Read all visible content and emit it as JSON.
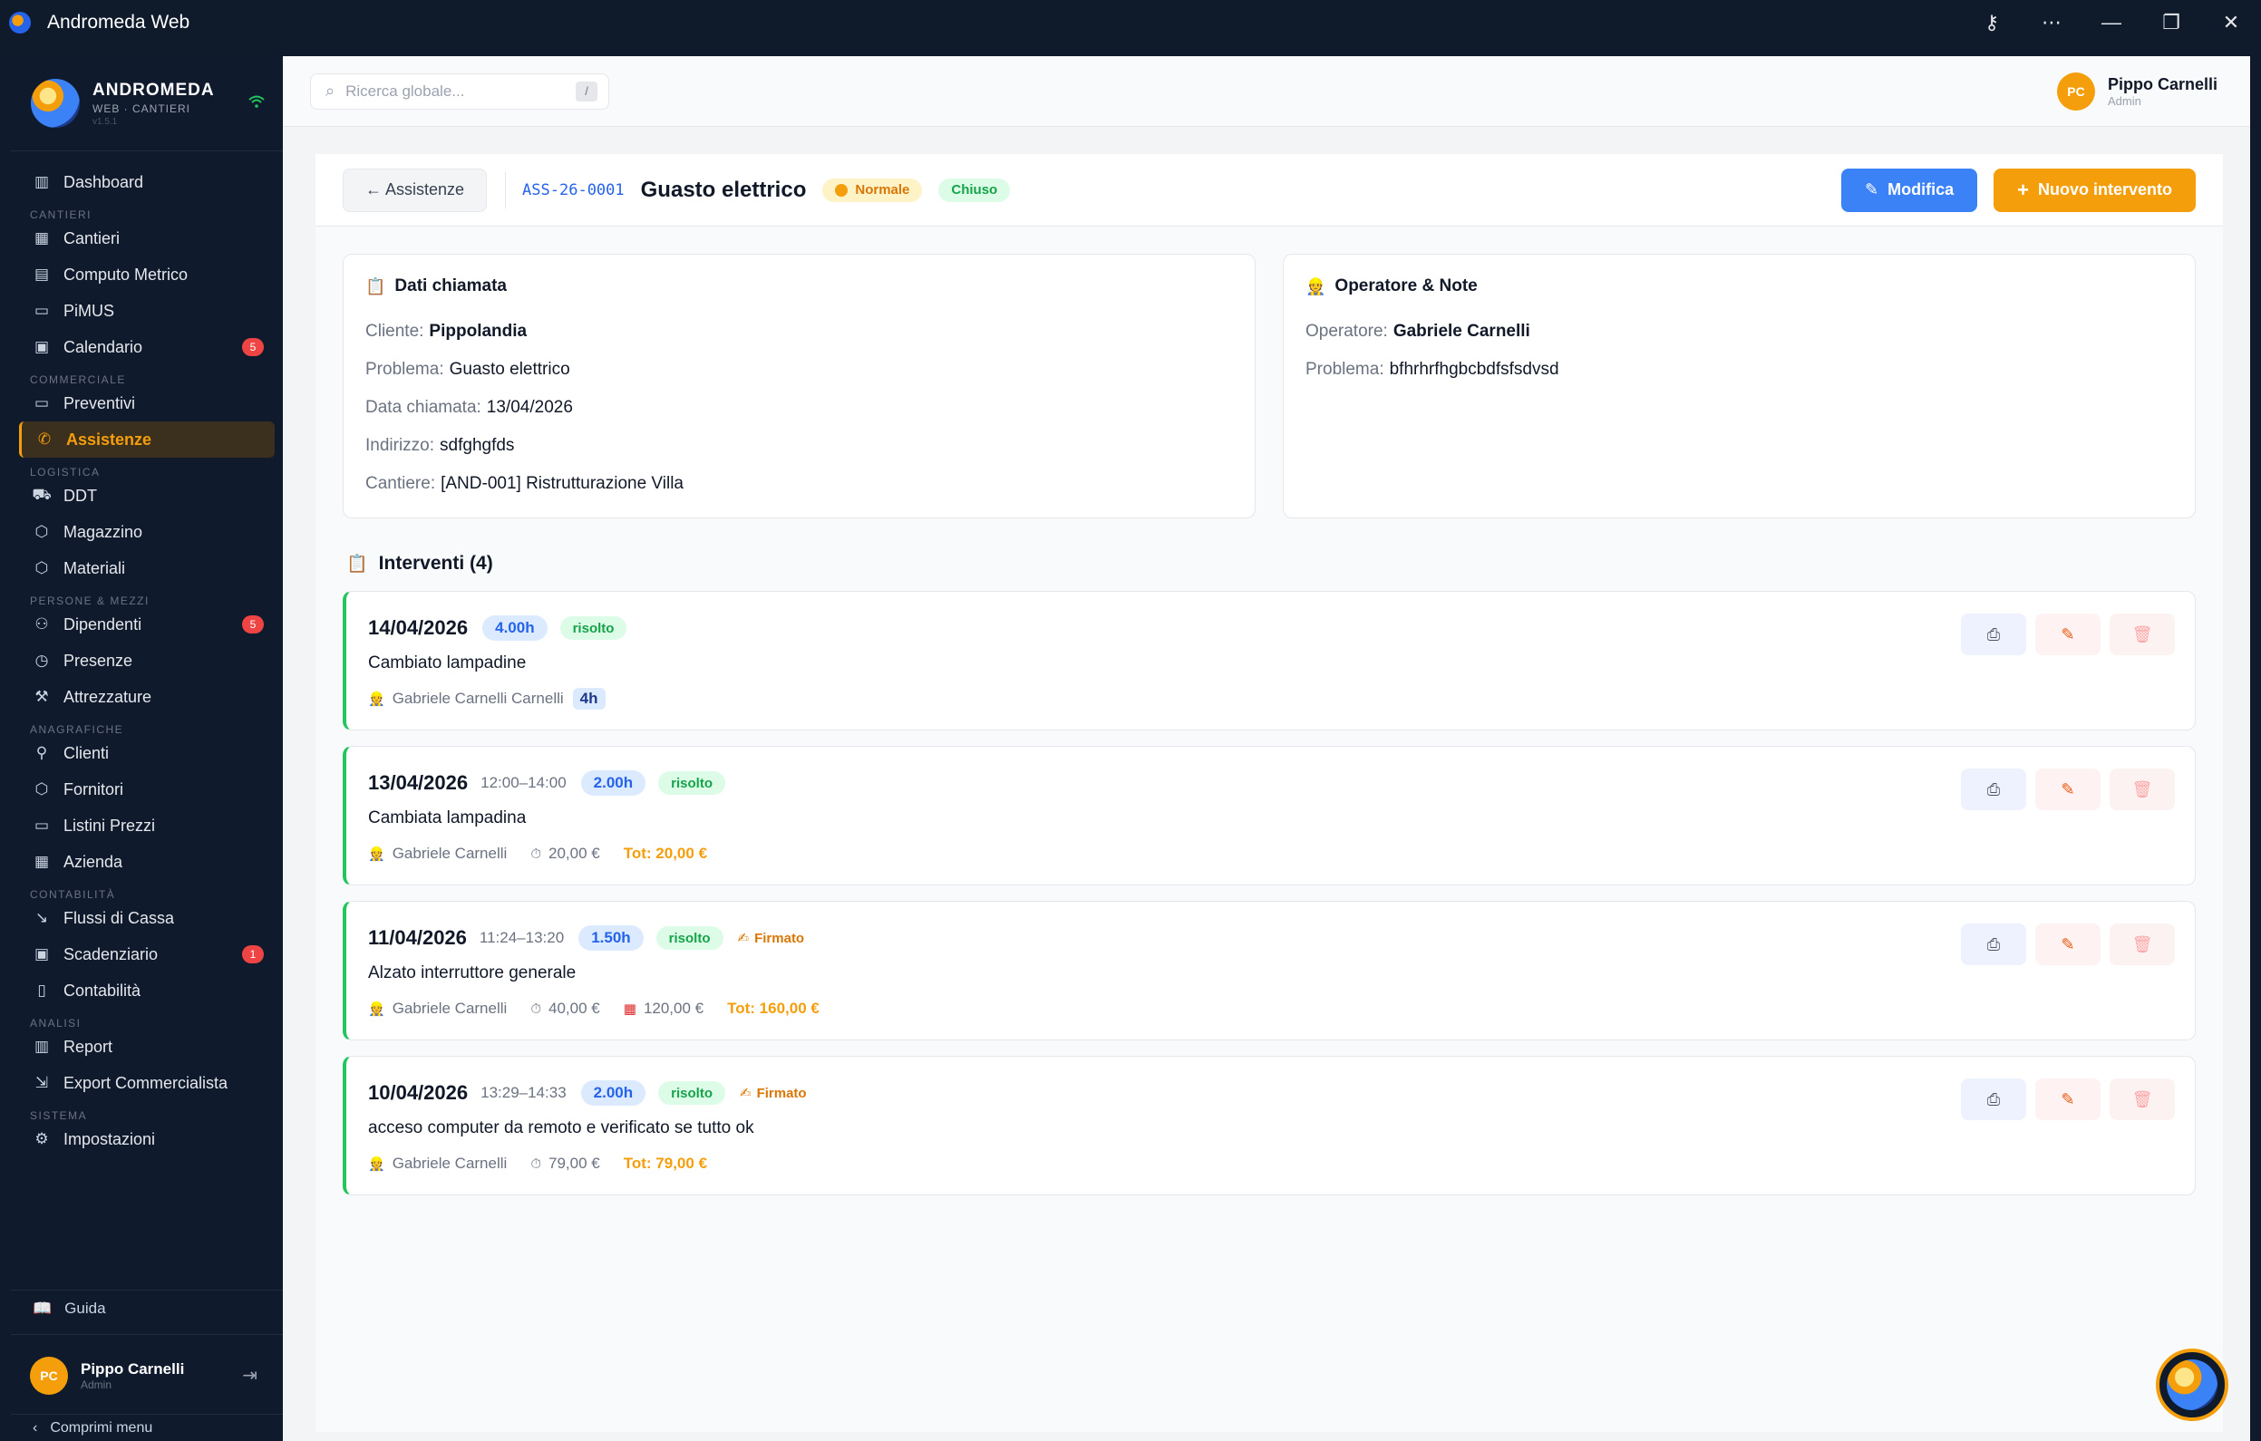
{
  "window": {
    "title": "Andromeda Web",
    "controls": [
      "key-icon",
      "more-icon",
      "minimize-icon",
      "restore-icon",
      "close-icon"
    ]
  },
  "sidebar": {
    "brand": {
      "name": "ANDROMEDA",
      "subtitle": "WEB · CANTIERI",
      "version": "v1.5.1"
    },
    "sections": [
      {
        "label": "",
        "items": [
          {
            "label": "Dashboard",
            "icon": "chart-icon"
          }
        ]
      },
      {
        "label": "CANTIERI",
        "items": [
          {
            "label": "Cantieri",
            "icon": "building-icon"
          },
          {
            "label": "Computo Metrico",
            "icon": "calculator-icon"
          },
          {
            "label": "PiMUS",
            "icon": "document-icon"
          },
          {
            "label": "Calendario",
            "icon": "calendar-icon",
            "badge": "5"
          }
        ]
      },
      {
        "label": "COMMERCIALE",
        "items": [
          {
            "label": "Preventivi",
            "icon": "document-icon"
          },
          {
            "label": "Assistenze",
            "icon": "phone-icon",
            "active": true
          }
        ]
      },
      {
        "label": "LOGISTICA",
        "items": [
          {
            "label": "DDT",
            "icon": "truck-icon"
          },
          {
            "label": "Magazzino",
            "icon": "box-icon"
          },
          {
            "label": "Materiali",
            "icon": "box-icon"
          }
        ]
      },
      {
        "label": "PERSONE & MEZZI",
        "items": [
          {
            "label": "Dipendenti",
            "icon": "users-icon",
            "badge": "5"
          },
          {
            "label": "Presenze",
            "icon": "clock-icon"
          },
          {
            "label": "Attrezzature",
            "icon": "wrench-icon"
          }
        ]
      },
      {
        "label": "ANAGRAFICHE",
        "items": [
          {
            "label": "Clienti",
            "icon": "user-icon"
          },
          {
            "label": "Fornitori",
            "icon": "box-icon"
          },
          {
            "label": "Listini Prezzi",
            "icon": "document-icon"
          },
          {
            "label": "Azienda",
            "icon": "building-icon"
          }
        ]
      },
      {
        "label": "CONTABILITÀ",
        "items": [
          {
            "label": "Flussi di Cassa",
            "icon": "trend-icon"
          },
          {
            "label": "Scadenziario",
            "icon": "calendar-icon",
            "badge": "1"
          },
          {
            "label": "Contabilità",
            "icon": "book-icon"
          }
        ]
      },
      {
        "label": "ANALISI",
        "items": [
          {
            "label": "Report",
            "icon": "chart-icon"
          },
          {
            "label": "Export Commercialista",
            "icon": "export-icon"
          }
        ]
      },
      {
        "label": "SISTEMA",
        "items": [
          {
            "label": "Impostazioni",
            "icon": "gear-icon"
          }
        ]
      }
    ],
    "guide_label": "Guida",
    "user": {
      "initials": "PC",
      "name": "Pippo Carnelli",
      "role": "Admin"
    },
    "collapse_label": "Comprimi menu"
  },
  "topbar": {
    "search_placeholder": "Ricerca globale...",
    "search_shortcut": "/",
    "user": {
      "initials": "PC",
      "name": "Pippo Carnelli",
      "role": "Admin"
    }
  },
  "header": {
    "back_label": "← Assistenze",
    "code": "ASS-26-0001",
    "title": "Guasto elettrico",
    "priority": "Normale",
    "status": "Chiuso",
    "edit_label": "Modifica",
    "new_label": "Nuovo intervento"
  },
  "dati_chiamata": {
    "title": "Dati chiamata",
    "fields": [
      {
        "label": "Cliente:",
        "value": "Pippolandia",
        "strong": true
      },
      {
        "label": "Problema:",
        "value": "Guasto elettrico"
      },
      {
        "label": "Data chiamata:",
        "value": "13/04/2026"
      },
      {
        "label": "Indirizzo:",
        "value": "sdfghgfds"
      },
      {
        "label": "Cantiere:",
        "value": "[AND-001] Ristrutturazione Villa"
      }
    ]
  },
  "operatore_note": {
    "title": "Operatore & Note",
    "fields": [
      {
        "label": "Operatore:",
        "value": "Gabriele Carnelli",
        "strong": true
      },
      {
        "label": "Problema:",
        "value": "bfhrhrfhgbcbdfsfsdvsd"
      }
    ]
  },
  "interventi": {
    "title": "Interventi (4)",
    "items": [
      {
        "date": "14/04/2026",
        "time": "",
        "hours": "4.00h",
        "status": "risolto",
        "signed": "",
        "description": "Cambiato lampadine",
        "operator": "Gabriele Carnelli Carnelli",
        "hours_chip": "4h",
        "labor": "",
        "material": "",
        "total": ""
      },
      {
        "date": "13/04/2026",
        "time": "12:00–14:00",
        "hours": "2.00h",
        "status": "risolto",
        "signed": "",
        "description": "Cambiata lampadina",
        "operator": "Gabriele Carnelli",
        "hours_chip": "",
        "labor": "20,00 €",
        "material": "",
        "total": "Tot: 20,00 €"
      },
      {
        "date": "11/04/2026",
        "time": "11:24–13:20",
        "hours": "1.50h",
        "status": "risolto",
        "signed": "Firmato",
        "description": "Alzato interruttore generale",
        "operator": "Gabriele Carnelli",
        "hours_chip": "",
        "labor": "40,00 €",
        "material": "120,00 €",
        "total": "Tot: 160,00 €"
      },
      {
        "date": "10/04/2026",
        "time": "13:29–14:33",
        "hours": "2.00h",
        "status": "risolto",
        "signed": "Firmato",
        "description": "acceso computer da remoto e verificato se tutto ok",
        "operator": "Gabriele Carnelli",
        "hours_chip": "",
        "labor": "79,00 €",
        "material": "",
        "total": "Tot: 79,00 €"
      }
    ]
  }
}
